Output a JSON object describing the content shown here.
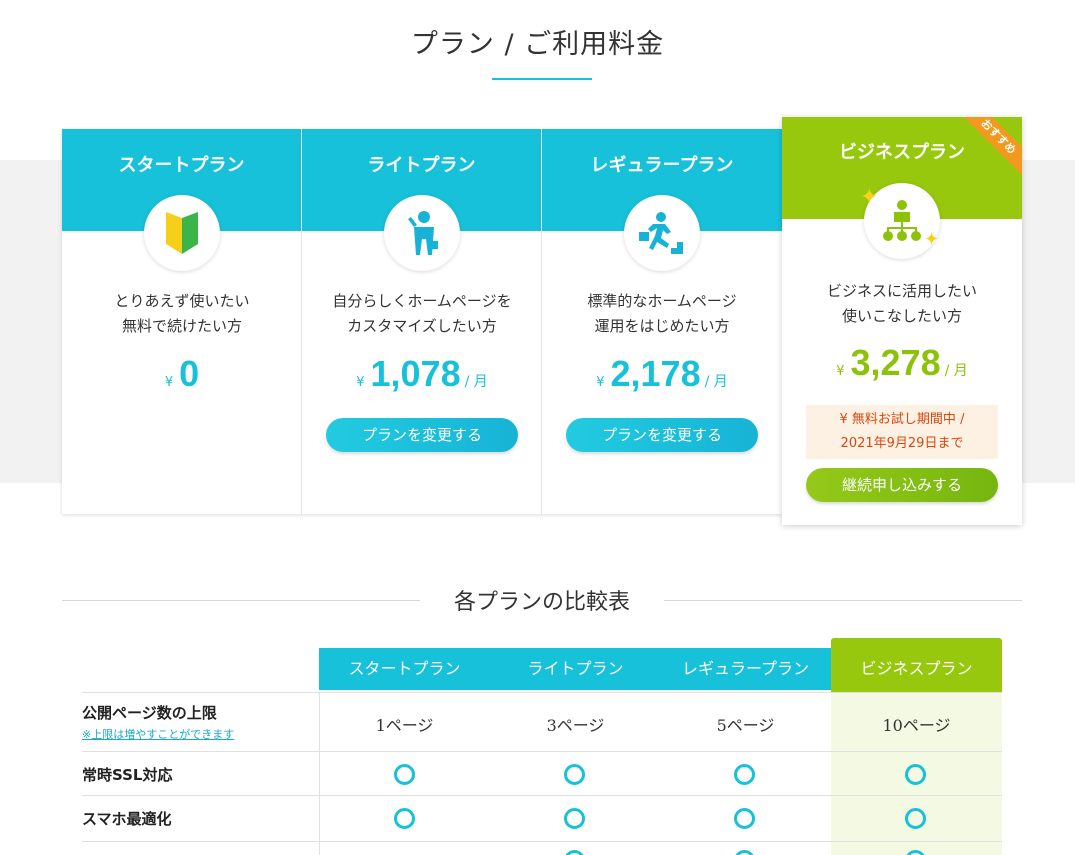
{
  "page_title": "プラン / ご利用料金",
  "plans": [
    {
      "name": "スタートプラン",
      "icon": "beginner-mark-icon",
      "desc1": "とりあえず使いたい",
      "desc2": "無料で続けたい方",
      "yen": "¥",
      "price": "0",
      "unit": "",
      "button": ""
    },
    {
      "name": "ライトプラン",
      "icon": "businessman-icon",
      "desc1": "自分らしくホームページを",
      "desc2": "カスタマイズしたい方",
      "yen": "¥",
      "price": "1,078",
      "unit": "/ 月",
      "button": "プランを変更する"
    },
    {
      "name": "レギュラープラン",
      "icon": "running-stairs-icon",
      "desc1": "標準的なホームページ",
      "desc2": "運用をはじめたい方",
      "yen": "¥",
      "price": "2,178",
      "unit": "/ 月",
      "button": "プランを変更する"
    }
  ],
  "business_plan": {
    "name": "ビジネスプラン",
    "ribbon": "おすすめ",
    "icon": "business-network-icon",
    "desc1": "ビジネスに活用したい",
    "desc2": "使いこなしたい方",
    "yen": "¥",
    "price": "3,278",
    "unit": "/ 月",
    "trial_line1": "¥ 無料お試し期間中 /",
    "trial_line2": "2021年9月29日まで",
    "button": "継続申し込みする"
  },
  "comparison": {
    "title": "各プランの比較表",
    "headers": [
      "スタートプラン",
      "ライトプラン",
      "レギュラープラン",
      "ビジネスプラン"
    ],
    "rows": [
      {
        "label": "公開ページ数の上限",
        "sub": "※上限は増やすことができます",
        "values": [
          "1ページ",
          "3ページ",
          "5ページ",
          "10ページ"
        ]
      },
      {
        "label": "常時SSL対応",
        "sub": "",
        "values": [
          "○",
          "○",
          "○",
          "○"
        ]
      },
      {
        "label": "スマホ最適化",
        "sub": "",
        "values": [
          "○",
          "○",
          "○",
          "○"
        ]
      }
    ]
  },
  "colors": {
    "accent": "#17c1da",
    "business": "#97c80d",
    "ribbon": "#f39a1e",
    "trial_text": "#d9480f"
  }
}
